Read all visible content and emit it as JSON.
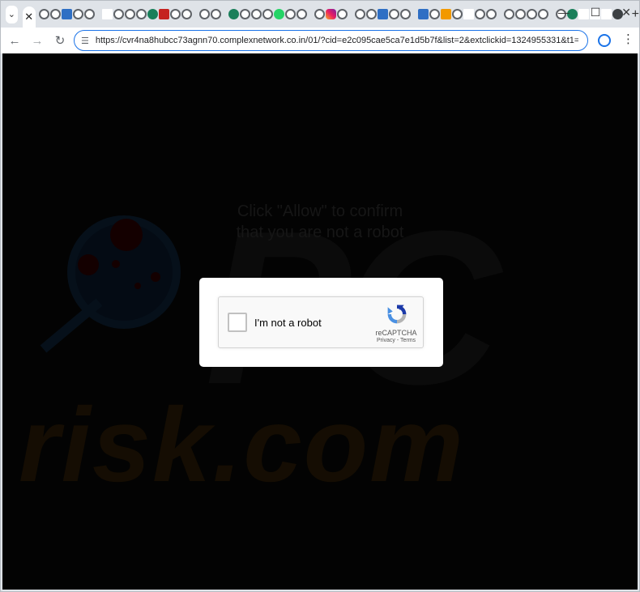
{
  "browser": {
    "active_tab_close": "✕",
    "new_tab": "+",
    "tab_search": "⌄",
    "window_controls": {
      "minimize": "—",
      "maximize": "☐",
      "close": "✕"
    },
    "url": "https://cvr4na8hubcc73agnn70.complexnetwork.co.in/01/?cid=e2c095cae5ca7e1d5b7f&list=2&extclickid=1324955331&t1=1324..."
  },
  "page": {
    "message_line1": "Click \"Allow\" to confirm",
    "message_line2": "that you are not a robot",
    "captcha": {
      "label": "I'm not a robot",
      "brand": "reCAPTCHA",
      "links": "Privacy - Terms"
    }
  },
  "watermark": {
    "brand_text": "risk.com",
    "logo_text": "PC"
  },
  "colors": {
    "accent": "#1a73e8",
    "page_background": "#030303"
  }
}
